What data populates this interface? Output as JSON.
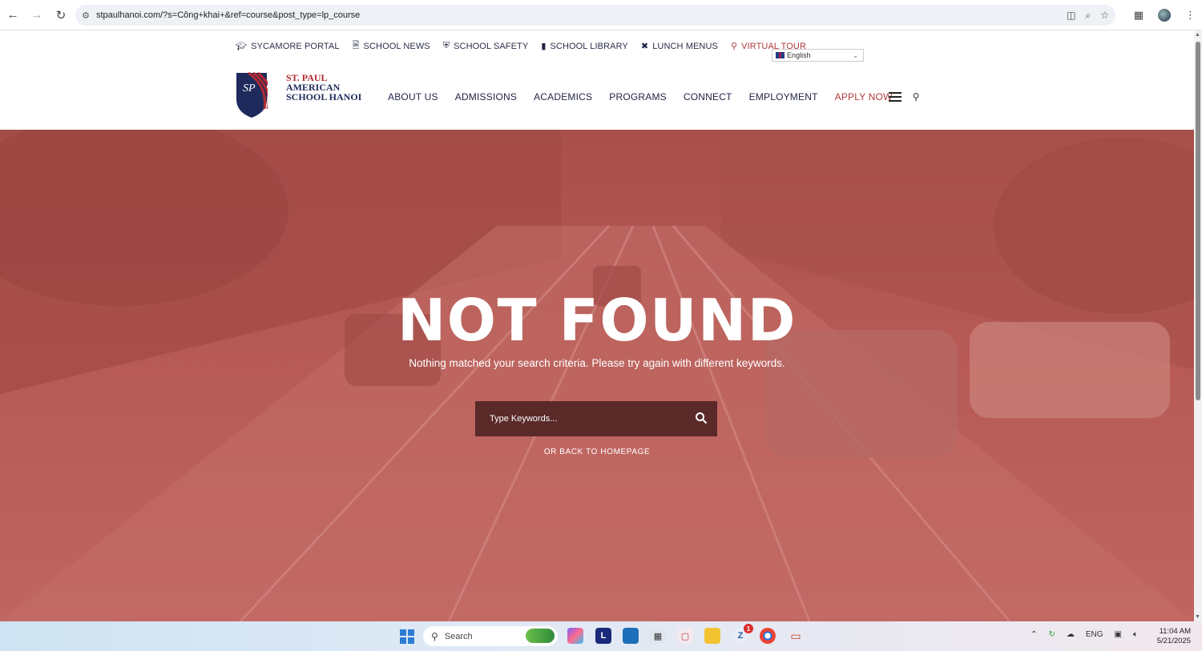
{
  "browser": {
    "url": "stpaulhanoi.com/?s=Công+khai+&ref=course&post_type=lp_course"
  },
  "topbar": {
    "links": [
      {
        "label": "SYCAMORE PORTAL",
        "icon": "graduation-cap-icon"
      },
      {
        "label": "SCHOOL NEWS",
        "icon": "document-icon"
      },
      {
        "label": "SCHOOL SAFETY",
        "icon": "shield-icon"
      },
      {
        "label": "SCHOOL LIBRARY",
        "icon": "book-icon"
      },
      {
        "label": "LUNCH MENUS",
        "icon": "utensils-icon"
      },
      {
        "label": "VIRTUAL TOUR",
        "icon": "map-pin-icon"
      }
    ],
    "language": "English"
  },
  "logo": {
    "line1": "ST. PAUL",
    "line2": "AMERICAN",
    "line3": "SCHOOL HANOI"
  },
  "nav": {
    "items": [
      "ABOUT US",
      "ADMISSIONS",
      "ACADEMICS",
      "PROGRAMS",
      "CONNECT",
      "EMPLOYMENT"
    ],
    "apply": "APPLY NOW"
  },
  "hero": {
    "title": "NOT FOUND",
    "subtitle": "Nothing matched your search criteria. Please try again with different keywords.",
    "search_placeholder": "Type Keywords...",
    "back_link": "OR BACK TO HOMEPAGE"
  },
  "taskbar": {
    "search_label": "Search",
    "tray_lang": "ENG",
    "time": "11:04 AM",
    "date": "5/21/2025",
    "badge": "1"
  },
  "colors": {
    "hero_overlay": "#b95c57",
    "brand_navy": "#1f2a5c",
    "brand_red": "#b22a32",
    "search_box": "#5a2a29"
  }
}
